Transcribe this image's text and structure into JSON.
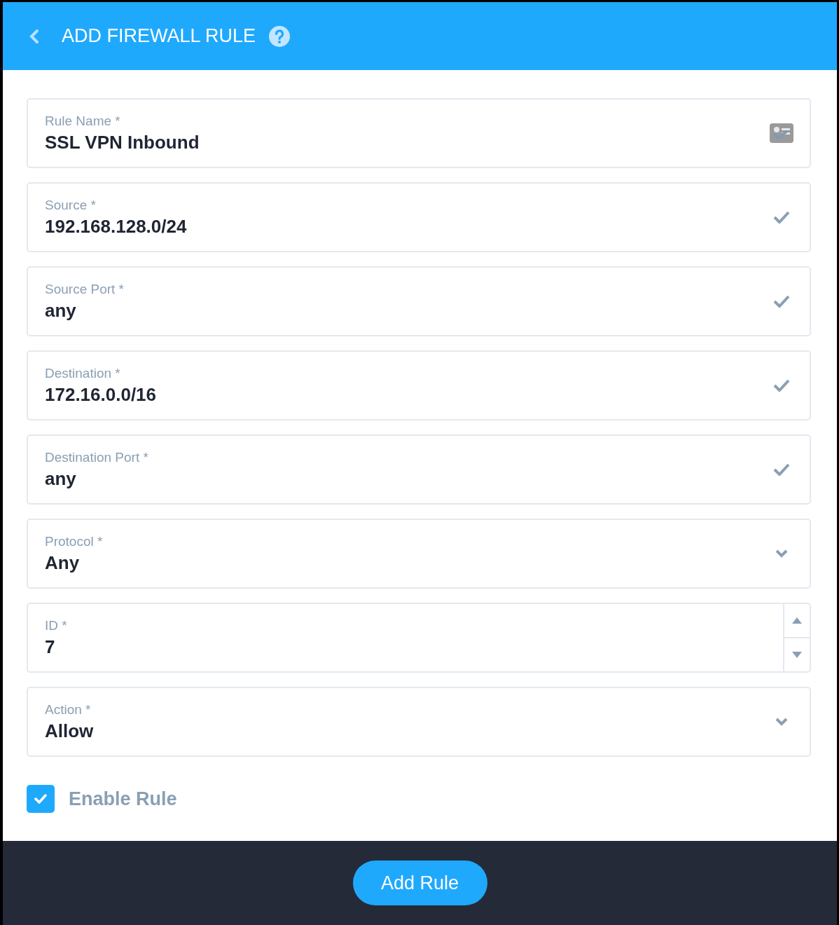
{
  "header": {
    "title": "ADD FIREWALL RULE"
  },
  "fields": [
    {
      "kind": "contact",
      "label": "Rule Name *",
      "value": "SSL VPN Inbound"
    },
    {
      "kind": "valid",
      "label": "Source *",
      "value": "192.168.128.0/24"
    },
    {
      "kind": "valid",
      "label": "Source Port *",
      "value": "any"
    },
    {
      "kind": "valid",
      "label": "Destination *",
      "value": "172.16.0.0/16"
    },
    {
      "kind": "valid",
      "label": "Destination Port *",
      "value": "any"
    },
    {
      "kind": "select",
      "label": "Protocol *",
      "value": "Any"
    },
    {
      "kind": "number",
      "label": "ID *",
      "value": "7"
    },
    {
      "kind": "select",
      "label": "Action *",
      "value": "Allow"
    }
  ],
  "enable_rule": {
    "label": "Enable Rule",
    "checked": true
  },
  "footer": {
    "button": "Add Rule"
  }
}
